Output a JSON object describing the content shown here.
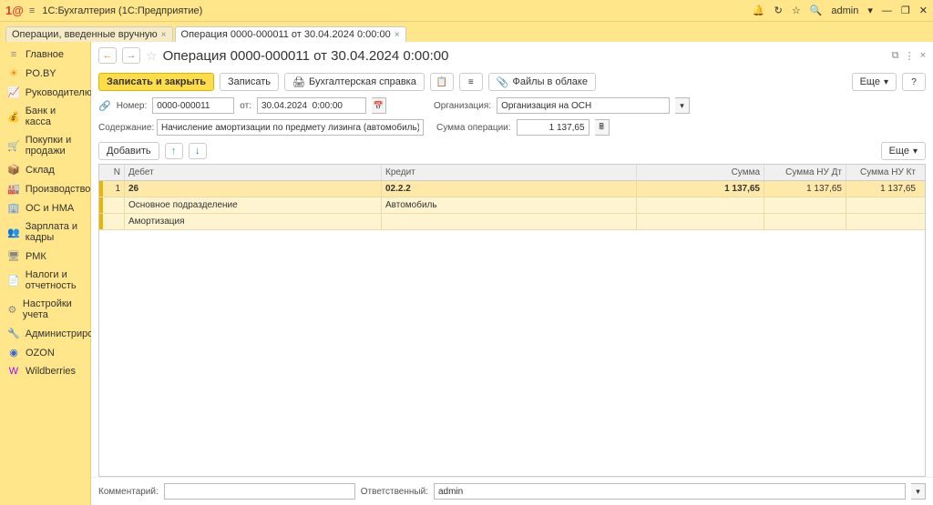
{
  "app": {
    "title": "1С:Бухгалтерия  (1С:Предприятие)",
    "user": "admin"
  },
  "tabs": [
    {
      "label": "Операции, введенные вручную"
    },
    {
      "label": "Операция 0000-000011 от 30.04.2024 0:00:00"
    }
  ],
  "sidebar": {
    "items": [
      {
        "label": "Главное"
      },
      {
        "label": "PO.BY"
      },
      {
        "label": "Руководителю"
      },
      {
        "label": "Банк и касса"
      },
      {
        "label": "Покупки и продажи"
      },
      {
        "label": "Склад"
      },
      {
        "label": "Производство"
      },
      {
        "label": "ОС и НМА"
      },
      {
        "label": "Зарплата и кадры"
      },
      {
        "label": "РМК"
      },
      {
        "label": "Налоги и отчетность"
      },
      {
        "label": "Настройки учета"
      },
      {
        "label": "Администрирование"
      },
      {
        "label": "OZON"
      },
      {
        "label": "Wildberries"
      }
    ]
  },
  "doc": {
    "title": "Операция 0000-000011 от 30.04.2024 0:00:00",
    "toolbar": {
      "save_close": "Записать и закрыть",
      "save": "Записать",
      "acct_ref": "Бухгалтерская справка",
      "cloud": "Файлы в облаке",
      "more": "Еще"
    },
    "form": {
      "num_lbl": "Номер:",
      "num": "0000-000011",
      "from_lbl": "от:",
      "date": "30.04.2024  0:00:00",
      "org_lbl": "Организация:",
      "org": "Организация на ОСН",
      "content_lbl": "Содержание:",
      "content": "Начисление амортизации по предмету лизинга (автомобиль)",
      "sumop_lbl": "Сумма операции:",
      "sumop": "1 137,65"
    },
    "tbl_toolbar": {
      "add": "Добавить",
      "more": "Еще"
    },
    "columns": {
      "n": "N",
      "debit": "Дебет",
      "credit": "Кредит",
      "sum": "Сумма",
      "nudt": "Сумма НУ Дт",
      "nukt": "Сумма НУ Кт"
    },
    "row": {
      "n": "1",
      "debit1": "26",
      "credit1": "02.2.2",
      "sum": "1 137,65",
      "nudt": "1 137,65",
      "nukt": "1 137,65",
      "debit2": "Основное подразделение",
      "credit2": "Автомобиль",
      "debit3": "Амортизация"
    },
    "footer": {
      "comment_lbl": "Комментарий:",
      "resp_lbl": "Ответственный:",
      "resp": "admin"
    }
  }
}
